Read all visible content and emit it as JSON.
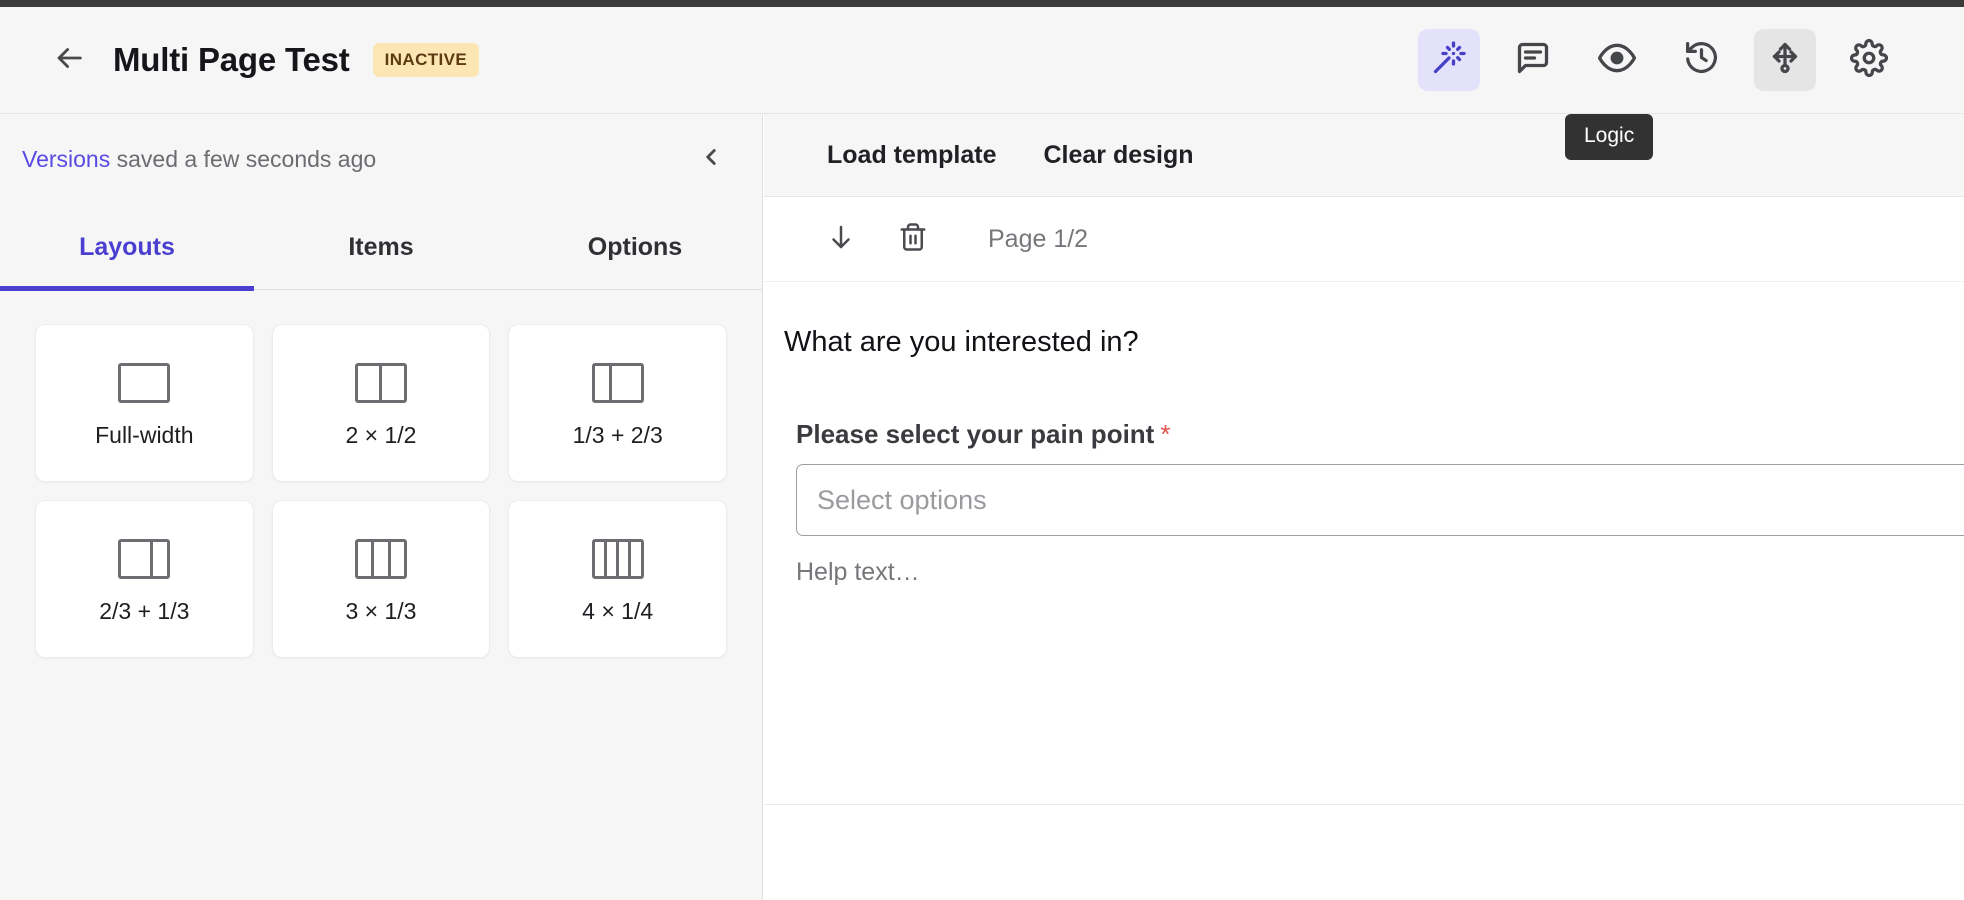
{
  "header": {
    "back_icon": "arrow-left-icon",
    "title": "Multi Page Test",
    "status_badge": "INACTIVE",
    "tools": [
      {
        "name": "design-tool",
        "icon": "magic-wand-icon",
        "state": "active-purple"
      },
      {
        "name": "comments-tool",
        "icon": "comment-icon",
        "state": "default"
      },
      {
        "name": "preview-tool",
        "icon": "eye-icon",
        "state": "default"
      },
      {
        "name": "history-tool",
        "icon": "history-clock-icon",
        "state": "default"
      },
      {
        "name": "logic-tool",
        "icon": "logic-branch-icon",
        "state": "active-gray"
      },
      {
        "name": "settings-tool",
        "icon": "gear-icon",
        "state": "default"
      }
    ],
    "tooltip": "Logic"
  },
  "sidebar": {
    "versions_link": "Versions",
    "versions_status": " saved a few seconds ago",
    "collapse_icon": "chevron-left-icon",
    "tabs": [
      {
        "label": "Layouts",
        "active": true
      },
      {
        "label": "Items",
        "active": false
      },
      {
        "label": "Options",
        "active": false
      }
    ],
    "layouts": [
      {
        "label": "Full-width",
        "cols": [
          1
        ]
      },
      {
        "label": "2 × 1/2",
        "cols": [
          1,
          1
        ]
      },
      {
        "label": "1/3 + 2/3",
        "cols": [
          1,
          2
        ]
      },
      {
        "label": "2/3 + 1/3",
        "cols": [
          2,
          1
        ]
      },
      {
        "label": "3 × 1/3",
        "cols": [
          1,
          1,
          1
        ]
      },
      {
        "label": "4 × 1/4",
        "cols": [
          1,
          1,
          1,
          1
        ]
      }
    ]
  },
  "panel": {
    "actions": [
      {
        "label": "Load template"
      },
      {
        "label": "Clear design"
      }
    ],
    "page": {
      "move_down_icon": "arrow-down-icon",
      "delete_icon": "trash-icon",
      "label": "Page 1/2"
    },
    "form": {
      "question": "What are you interested in?",
      "field_label": "Please select your pain point",
      "required_marker": "*",
      "select_placeholder": "Select options",
      "help_text": "Help text…"
    }
  },
  "colors": {
    "accent_purple": "#4a3fd0",
    "tool_active_bg": "#e4e1fb",
    "tool_active_gray": "#e5e5e6",
    "badge_bg": "#fbe6b4",
    "badge_text": "#5c3a12",
    "required_red": "#e0544a",
    "tooltip_bg": "#323233"
  }
}
